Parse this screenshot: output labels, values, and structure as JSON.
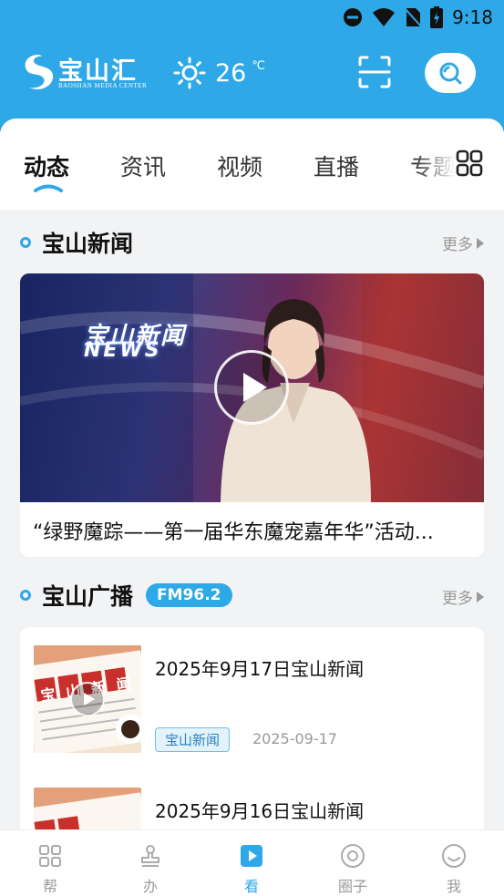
{
  "status_bar": {
    "time": "9:18",
    "icons": [
      "dnd-icon",
      "wifi-icon",
      "no-sim-icon",
      "battery-charging-icon"
    ]
  },
  "header": {
    "logo_cn": "宝山汇",
    "logo_en": "BAOSHAN MEDIA CENTER",
    "weather": {
      "icon": "sun-icon",
      "temperature": "26",
      "unit": "℃"
    },
    "colors": {
      "brand": "#2ea8e6"
    }
  },
  "tabs": [
    {
      "label": "动态",
      "active": true
    },
    {
      "label": "资讯",
      "active": false
    },
    {
      "label": "视频",
      "active": false
    },
    {
      "label": "直播",
      "active": false
    },
    {
      "label": "专题",
      "active": false
    }
  ],
  "news_section": {
    "title": "宝山新闻",
    "more": "更多",
    "video": {
      "logo_cn": "宝山新闻",
      "logo_en": "NEWS",
      "caption": "“绿野魔踪——第一届华东魔宠嘉年华”活动..."
    }
  },
  "radio_section": {
    "title": "宝山广播",
    "badge": "FM96.2",
    "more": "更多",
    "items": [
      {
        "title": "2025年9月17日宝山新闻",
        "tag": "宝山新闻",
        "date": "2025-09-17",
        "thumb_text": [
          "宝",
          "山",
          "新",
          "闻"
        ]
      },
      {
        "title": "2025年9月16日宝山新闻",
        "tag": "",
        "date": "",
        "thumb_text": []
      }
    ]
  },
  "bottom_nav": [
    {
      "label": "帮",
      "icon": "grid-icon",
      "active": false
    },
    {
      "label": "办",
      "icon": "stamp-icon",
      "active": false
    },
    {
      "label": "看",
      "icon": "play-icon",
      "active": true
    },
    {
      "label": "圈子",
      "icon": "target-icon",
      "active": false
    },
    {
      "label": "我",
      "icon": "smiley-icon",
      "active": false
    }
  ]
}
